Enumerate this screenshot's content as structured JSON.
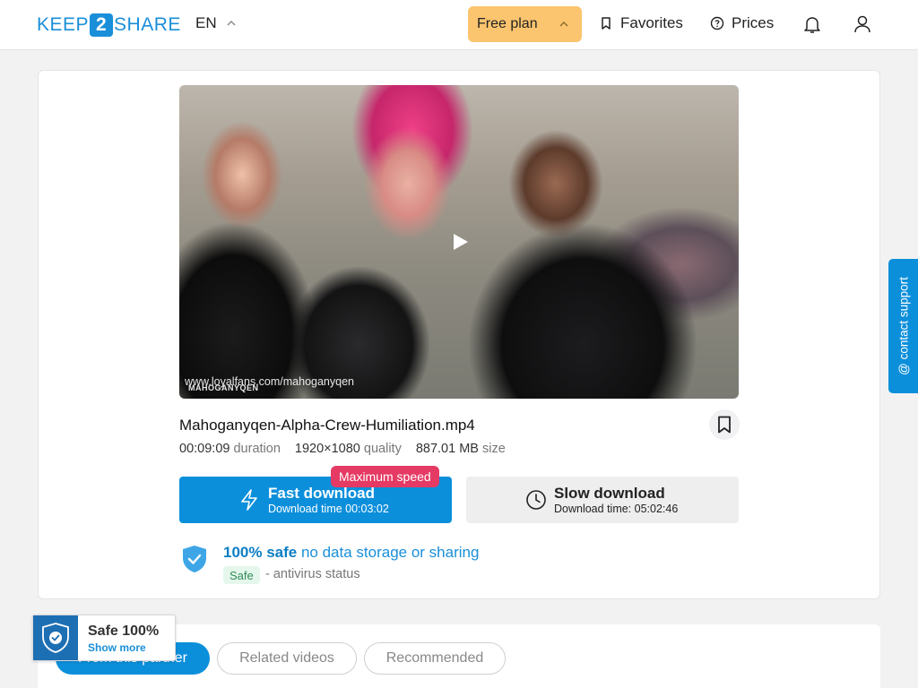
{
  "header": {
    "logo": {
      "left": "KEEP",
      "middle": "2",
      "right": "SHARE"
    },
    "language": "EN",
    "plan_button": "Free plan",
    "favorites": "Favorites",
    "prices": "Prices"
  },
  "video": {
    "watermark_url": "www.loyalfans.com/mahoganyqen",
    "watermark_brand": "MAHOGANYQEN"
  },
  "file": {
    "name": "Mahoganyqen-Alpha-Crew-Humiliation.mp4",
    "duration_value": "00:09:09",
    "duration_label": "duration",
    "quality_value": "1920×1080",
    "quality_label": "quality",
    "size_value": "887.01 MB",
    "size_label": "size"
  },
  "downloads": {
    "badge": "Maximum speed",
    "fast_title": "Fast download",
    "fast_subtitle": "Download time 00:03:02",
    "slow_title": "Slow download",
    "slow_subtitle": "Download time: 05:02:46"
  },
  "safety": {
    "bold": "100% safe",
    "rest": " no data storage or sharing",
    "badge": "Safe",
    "status": "- antivirus status"
  },
  "contact_support": "@ contact support",
  "tabs": [
    "From this partner",
    "Related videos",
    "Recommended"
  ],
  "safe_widget": {
    "title": "Safe 100%",
    "link": "Show more"
  },
  "colors": {
    "accent": "#0c8fdb",
    "plan": "#fbc46e",
    "badge": "#e53a63"
  }
}
